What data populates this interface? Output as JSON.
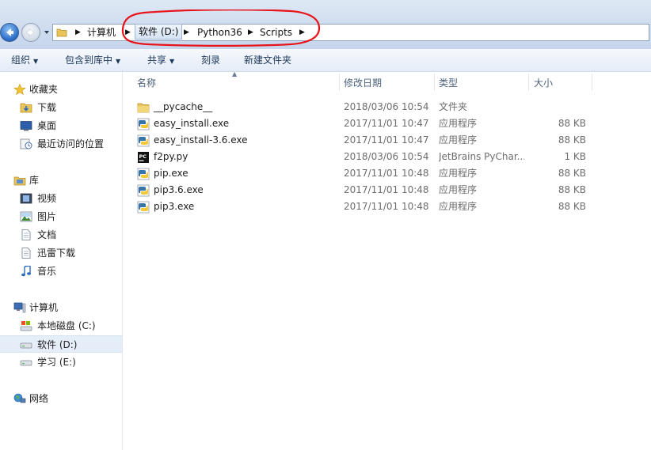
{
  "address": {
    "breadcrumbs": [
      {
        "label": "计算机"
      },
      {
        "label": "软件 (D:)"
      },
      {
        "label": "Python36"
      },
      {
        "label": "Scripts"
      }
    ]
  },
  "toolbar": {
    "organize": "组织",
    "include_in_library": "包含到库中",
    "share": "共享",
    "burn": "刻录",
    "new_folder": "新建文件夹"
  },
  "sidebar": {
    "favorites": {
      "label": "收藏夹",
      "items": [
        {
          "label": "下载",
          "icon": "download-folder-icon"
        },
        {
          "label": "桌面",
          "icon": "desktop-icon"
        },
        {
          "label": "最近访问的位置",
          "icon": "recent-places-icon"
        }
      ]
    },
    "libraries": {
      "label": "库",
      "items": [
        {
          "label": "视频",
          "icon": "video-library-icon"
        },
        {
          "label": "图片",
          "icon": "picture-library-icon"
        },
        {
          "label": "文档",
          "icon": "document-library-icon"
        },
        {
          "label": "迅雷下载",
          "icon": "thunder-download-icon"
        },
        {
          "label": "音乐",
          "icon": "music-library-icon"
        }
      ]
    },
    "computer": {
      "label": "计算机",
      "items": [
        {
          "label": "本地磁盘 (C:)",
          "icon": "system-drive-icon"
        },
        {
          "label": "软件 (D:)",
          "icon": "drive-icon",
          "selected": true
        },
        {
          "label": "学习 (E:)",
          "icon": "drive-icon"
        }
      ]
    },
    "network": {
      "label": "网络"
    }
  },
  "columns": {
    "name": "名称",
    "modified": "修改日期",
    "type": "类型",
    "size": "大小"
  },
  "files": [
    {
      "name": "__pycache__",
      "modified": "2018/03/06 10:54",
      "type": "文件夹",
      "size": "",
      "icon": "folder-icon"
    },
    {
      "name": "easy_install.exe",
      "modified": "2017/11/01 10:47",
      "type": "应用程序",
      "size": "88 KB",
      "icon": "python-exe-icon"
    },
    {
      "name": "easy_install-3.6.exe",
      "modified": "2017/11/01 10:47",
      "type": "应用程序",
      "size": "88 KB",
      "icon": "python-exe-icon"
    },
    {
      "name": "f2py.py",
      "modified": "2018/03/06 10:54",
      "type": "JetBrains PyChar...",
      "size": "1 KB",
      "icon": "pycharm-file-icon"
    },
    {
      "name": "pip.exe",
      "modified": "2017/11/01 10:48",
      "type": "应用程序",
      "size": "88 KB",
      "icon": "python-exe-icon"
    },
    {
      "name": "pip3.6.exe",
      "modified": "2017/11/01 10:48",
      "type": "应用程序",
      "size": "88 KB",
      "icon": "python-exe-icon"
    },
    {
      "name": "pip3.exe",
      "modified": "2017/11/01 10:48",
      "type": "应用程序",
      "size": "88 KB",
      "icon": "python-exe-icon"
    }
  ],
  "colors": {
    "annotation": "#e8141c",
    "selection": "#e5eef8",
    "toolbar_text": "#1e395b"
  }
}
